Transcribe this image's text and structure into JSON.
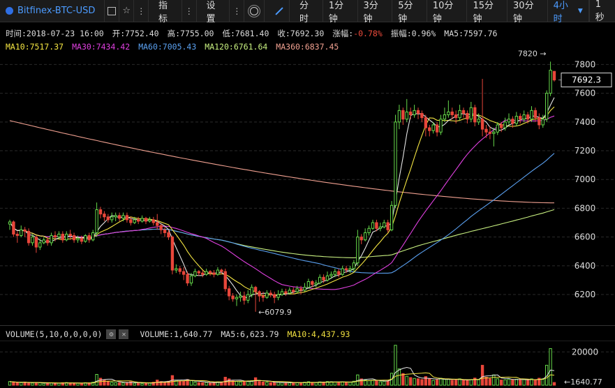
{
  "toolbar": {
    "symbol": "Bitfinex-BTC-USD",
    "indicators_label": "指标",
    "settings_label": "设置",
    "timeframes": [
      "分时",
      "1分钟",
      "3分钟",
      "5分钟",
      "10分钟",
      "15分钟",
      "30分钟",
      "4小时"
    ],
    "active_timeframe": "4小时",
    "extra_timeframe": "1秒",
    "icons": [
      "square-icon",
      "star-icon",
      "more-icon",
      "sun-icon",
      "pen-icon",
      "chevron-down-icon"
    ]
  },
  "info": {
    "time": "时间:2018-07-23 16:00",
    "open": "开:7752.40",
    "high": "高:7755.00",
    "low": "低:7681.40",
    "close": "收:7692.30",
    "change_label": "涨幅:",
    "change_value": "-0.78%",
    "amplitude": "振幅:0.96%",
    "ma5": "MA5:7597.76",
    "ma10": "MA10:7517.37",
    "ma30": "MA30:7434.42",
    "ma60": "MA60:7005.43",
    "ma120": "MA120:6761.64",
    "ma360": "MA360:6837.45"
  },
  "volume_info": {
    "title": "VOLUME(5,10,0,0,0,0)",
    "volume": "VOLUME:1,640.77",
    "ma5": "MA5:6,623.79",
    "ma10": "MA10:4,437.93"
  },
  "colors": {
    "up": "#66d94a",
    "down": "#e8463a",
    "ma5": "#e6e6e6",
    "ma10": "#f5e642",
    "ma30": "#e040e0",
    "ma60": "#5aa0f0",
    "ma120": "#c8f080",
    "ma360": "#f0a090",
    "accent": "#4c9bff"
  },
  "chart_data": {
    "type": "candlestick",
    "price_axis": {
      "ticks": [
        6200,
        6400,
        6600,
        6800,
        7000,
        7200,
        7400,
        7600,
        7800
      ],
      "range": [
        6040,
        7870
      ]
    },
    "current_price_label": "7692.3",
    "high_annotation": "7820 →",
    "low_annotation": "←6079.9",
    "volume_axis": {
      "ticks": [
        20000
      ]
    },
    "current_volume_label": "←1640.77",
    "candles": [
      [
        6690,
        6705,
        6650,
        6720
      ],
      [
        6705,
        6620,
        6600,
        6715
      ],
      [
        6620,
        6610,
        6560,
        6640
      ],
      [
        6610,
        6650,
        6600,
        6680
      ],
      [
        6650,
        6640,
        6600,
        6670
      ],
      [
        6640,
        6560,
        6540,
        6660
      ],
      [
        6560,
        6600,
        6540,
        6620
      ],
      [
        6600,
        6530,
        6490,
        6610
      ],
      [
        6530,
        6560,
        6510,
        6590
      ],
      [
        6560,
        6580,
        6550,
        6600
      ],
      [
        6580,
        6560,
        6540,
        6600
      ],
      [
        6560,
        6610,
        6540,
        6630
      ],
      [
        6610,
        6600,
        6570,
        6640
      ],
      [
        6600,
        6620,
        6590,
        6640
      ],
      [
        6620,
        6580,
        6560,
        6640
      ],
      [
        6580,
        6620,
        6570,
        6640
      ],
      [
        6620,
        6610,
        6580,
        6650
      ],
      [
        6610,
        6580,
        6560,
        6630
      ],
      [
        6580,
        6590,
        6560,
        6610
      ],
      [
        6590,
        6570,
        6550,
        6610
      ],
      [
        6570,
        6610,
        6560,
        6620
      ],
      [
        6610,
        6580,
        6560,
        6630
      ],
      [
        6580,
        6630,
        6570,
        6650
      ],
      [
        6630,
        6790,
        6600,
        6840
      ],
      [
        6790,
        6760,
        6730,
        6810
      ],
      [
        6760,
        6740,
        6710,
        6780
      ],
      [
        6740,
        6720,
        6700,
        6760
      ],
      [
        6720,
        6740,
        6700,
        6770
      ],
      [
        6740,
        6750,
        6710,
        6770
      ],
      [
        6750,
        6730,
        6710,
        6770
      ],
      [
        6730,
        6750,
        6710,
        6770
      ],
      [
        6750,
        6720,
        6700,
        6770
      ],
      [
        6720,
        6700,
        6680,
        6740
      ],
      [
        6700,
        6720,
        6690,
        6740
      ],
      [
        6720,
        6710,
        6690,
        6740
      ],
      [
        6710,
        6730,
        6700,
        6750
      ],
      [
        6730,
        6710,
        6690,
        6740
      ],
      [
        6710,
        6720,
        6700,
        6740
      ],
      [
        6720,
        6700,
        6680,
        6740
      ],
      [
        6700,
        6680,
        6650,
        6760
      ],
      [
        6680,
        6650,
        6620,
        6690
      ],
      [
        6650,
        6630,
        6600,
        6670
      ],
      [
        6630,
        6600,
        6580,
        6650
      ],
      [
        6600,
        6370,
        6340,
        6610
      ],
      [
        6370,
        6380,
        6350,
        6410
      ],
      [
        6380,
        6360,
        6340,
        6400
      ],
      [
        6360,
        6340,
        6300,
        6390
      ],
      [
        6340,
        6280,
        6260,
        6360
      ],
      [
        6280,
        6330,
        6260,
        6350
      ],
      [
        6330,
        6360,
        6320,
        6380
      ],
      [
        6360,
        6350,
        6330,
        6370
      ],
      [
        6350,
        6340,
        6320,
        6370
      ],
      [
        6340,
        6360,
        6330,
        6380
      ],
      [
        6360,
        6350,
        6330,
        6370
      ],
      [
        6350,
        6340,
        6320,
        6370
      ],
      [
        6340,
        6370,
        6330,
        6390
      ],
      [
        6370,
        6360,
        6340,
        6380
      ],
      [
        6360,
        6240,
        6220,
        6380
      ],
      [
        6240,
        6190,
        6160,
        6260
      ],
      [
        6190,
        6170,
        6150,
        6210
      ],
      [
        6170,
        6180,
        6120,
        6200
      ],
      [
        6180,
        6190,
        6150,
        6220
      ],
      [
        6190,
        6160,
        6130,
        6220
      ],
      [
        6160,
        6200,
        6140,
        6230
      ],
      [
        6200,
        6250,
        6180,
        6270
      ],
      [
        6250,
        6220,
        6080,
        6260
      ],
      [
        6220,
        6190,
        6150,
        6230
      ],
      [
        6190,
        6180,
        6150,
        6220
      ],
      [
        6180,
        6210,
        6170,
        6230
      ],
      [
        6210,
        6200,
        6180,
        6230
      ],
      [
        6200,
        6180,
        6140,
        6220
      ],
      [
        6180,
        6200,
        6160,
        6230
      ],
      [
        6200,
        6220,
        6190,
        6240
      ],
      [
        6220,
        6210,
        6190,
        6240
      ],
      [
        6210,
        6230,
        6200,
        6250
      ],
      [
        6230,
        6220,
        6200,
        6250
      ],
      [
        6220,
        6240,
        6210,
        6260
      ],
      [
        6240,
        6230,
        6200,
        6260
      ],
      [
        6230,
        6250,
        6220,
        6280
      ],
      [
        6250,
        6290,
        6240,
        6310
      ],
      [
        6290,
        6270,
        6250,
        6300
      ],
      [
        6270,
        6280,
        6250,
        6300
      ],
      [
        6280,
        6320,
        6270,
        6340
      ],
      [
        6320,
        6300,
        6280,
        6340
      ],
      [
        6300,
        6330,
        6290,
        6360
      ],
      [
        6330,
        6340,
        6310,
        6360
      ],
      [
        6340,
        6360,
        6320,
        6380
      ],
      [
        6360,
        6340,
        6320,
        6380
      ],
      [
        6340,
        6380,
        6330,
        6400
      ],
      [
        6380,
        6370,
        6350,
        6400
      ],
      [
        6370,
        6380,
        6350,
        6400
      ],
      [
        6380,
        6420,
        6360,
        6440
      ],
      [
        6420,
        6600,
        6400,
        6650
      ],
      [
        6600,
        6580,
        6550,
        6620
      ],
      [
        6580,
        6630,
        6570,
        6660
      ],
      [
        6630,
        6660,
        6610,
        6680
      ],
      [
        6660,
        6700,
        6650,
        6720
      ],
      [
        6700,
        6660,
        6640,
        6720
      ],
      [
        6660,
        6670,
        6640,
        6700
      ],
      [
        6670,
        6700,
        6660,
        6720
      ],
      [
        6700,
        6650,
        6630,
        6720
      ],
      [
        6650,
        6820,
        6640,
        6850
      ],
      [
        6820,
        7400,
        6800,
        7450
      ],
      [
        7400,
        7480,
        7350,
        7520
      ],
      [
        7480,
        7420,
        7380,
        7500
      ],
      [
        7420,
        7470,
        7400,
        7560
      ],
      [
        7470,
        7450,
        7420,
        7500
      ],
      [
        7450,
        7480,
        7430,
        7520
      ],
      [
        7480,
        7460,
        7420,
        7500
      ],
      [
        7460,
        7430,
        7400,
        7480
      ],
      [
        7430,
        7360,
        7300,
        7450
      ],
      [
        7360,
        7340,
        7300,
        7380
      ],
      [
        7340,
        7380,
        7320,
        7400
      ],
      [
        7380,
        7330,
        7300,
        7400
      ],
      [
        7330,
        7420,
        7310,
        7450
      ],
      [
        7420,
        7450,
        7400,
        7500
      ],
      [
        7450,
        7470,
        7430,
        7550
      ],
      [
        7470,
        7450,
        7420,
        7500
      ],
      [
        7450,
        7430,
        7390,
        7480
      ],
      [
        7430,
        7480,
        7410,
        7520
      ],
      [
        7480,
        7460,
        7430,
        7500
      ],
      [
        7460,
        7420,
        7390,
        7480
      ],
      [
        7420,
        7500,
        7400,
        7540
      ],
      [
        7500,
        7400,
        7370,
        7520
      ],
      [
        7400,
        7420,
        7380,
        7460
      ],
      [
        7420,
        7350,
        7300,
        7700
      ],
      [
        7350,
        7330,
        7290,
        7380
      ],
      [
        7330,
        7320,
        7280,
        7370
      ],
      [
        7320,
        7330,
        7230,
        7360
      ],
      [
        7330,
        7380,
        7310,
        7400
      ],
      [
        7380,
        7360,
        7330,
        7400
      ],
      [
        7360,
        7400,
        7340,
        7430
      ],
      [
        7400,
        7420,
        7380,
        7460
      ],
      [
        7420,
        7390,
        7360,
        7440
      ],
      [
        7390,
        7440,
        7370,
        7470
      ],
      [
        7440,
        7420,
        7390,
        7460
      ],
      [
        7420,
        7450,
        7400,
        7480
      ],
      [
        7450,
        7420,
        7390,
        7470
      ],
      [
        7420,
        7480,
        7400,
        7510
      ],
      [
        7480,
        7430,
        7400,
        7500
      ],
      [
        7430,
        7380,
        7350,
        7460
      ],
      [
        7380,
        7420,
        7360,
        7450
      ],
      [
        7420,
        7600,
        7400,
        7620
      ],
      [
        7600,
        7760,
        7580,
        7820
      ],
      [
        7752.4,
        7692.3,
        7681.4,
        7755
      ]
    ],
    "volumes": [
      2200,
      1800,
      1500,
      1600,
      1900,
      1400,
      1300,
      1600,
      1500,
      1200,
      1100,
      1400,
      1300,
      1200,
      1500,
      1600,
      1400,
      1300,
      1200,
      1100,
      1500,
      1400,
      1800,
      6500,
      4200,
      3000,
      2500,
      1800,
      1600,
      1500,
      1400,
      1700,
      2100,
      1300,
      1200,
      1100,
      1500,
      1400,
      1800,
      3100,
      2200,
      1900,
      2400,
      5800,
      3000,
      2400,
      2300,
      3400,
      2800,
      1900,
      1600,
      1500,
      1700,
      1400,
      1600,
      2000,
      1800,
      4800,
      3800,
      2600,
      2300,
      2000,
      2100,
      2400,
      2700,
      4500,
      2200,
      1900,
      1800,
      1600,
      1500,
      1700,
      1600,
      1500,
      1400,
      1700,
      1600,
      1500,
      1800,
      2100,
      1700,
      1600,
      2000,
      1900,
      2200,
      2100,
      1900,
      1800,
      2000,
      1900,
      1800,
      2400,
      6200,
      3800,
      3200,
      2800,
      3000,
      2500,
      2100,
      2400,
      2600,
      7200,
      24000,
      9800,
      7000,
      5400,
      4600,
      4100,
      3900,
      3400,
      5200,
      3800,
      2900,
      3200,
      4200,
      3800,
      3600,
      3000,
      3100,
      3800,
      3100,
      2800,
      3400,
      4300,
      3300,
      12000,
      4800,
      3900,
      6200,
      3900,
      3100,
      3300,
      3700,
      3200,
      3600,
      3300,
      3400,
      3000,
      3800,
      3300,
      4200,
      3900,
      12000,
      22000,
      1640.77
    ],
    "ma360_endpoints": [
      7410,
      6837.45
    ]
  }
}
